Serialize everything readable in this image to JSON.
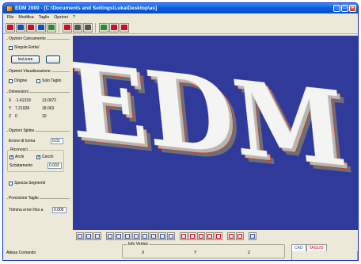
{
  "window": {
    "title": "EDM 2000 - [C:\\Documents and Settings\\Luka\\Desktop\\as]",
    "controls": [
      "_",
      "□",
      "×"
    ]
  },
  "menu": [
    "File",
    "Modifica",
    "Taglio",
    "Opzioni",
    "?"
  ],
  "toolbar": {
    "buttons": [
      {
        "icon": "open-folder-icon",
        "color": "#c8102e"
      },
      {
        "icon": "open-file-icon",
        "color": "#1a4fb5"
      },
      {
        "icon": "save-file-icon",
        "color": "#c8102e"
      },
      {
        "icon": "import-file-icon",
        "color": "#1a4fb5"
      },
      {
        "icon": "export-icon",
        "color": "#2e8b2e"
      },
      {
        "icon": "home-icon",
        "color": "#c8102e"
      },
      {
        "icon": "edit-icon",
        "color": "#555555"
      },
      {
        "icon": "shape-icon",
        "color": "#555555"
      },
      {
        "icon": "disk-icon",
        "color": "#2e8b2e"
      },
      {
        "icon": "print-icon",
        "color": "#c8102e"
      },
      {
        "icon": "exit-icon",
        "color": "#c8102e"
      }
    ]
  },
  "left_panel": {
    "opzioni_caricamento": {
      "title": "Opzioni Caricamento",
      "singola_entita": "Singole Entita'",
      "isolinee_button": "IsoLinee"
    },
    "opzioni_visualizzazione": {
      "title": "Opzioni Visualizzazione",
      "origine": "Origine",
      "solo_taglio": "Solo Taglio"
    },
    "dimensioni": {
      "title": "Dimensioni",
      "rows": [
        {
          "axis": "X",
          "min": "-1.41318",
          "max": "13.0072"
        },
        {
          "axis": "Y",
          "min": "7.21928",
          "max": "18.063"
        },
        {
          "axis": "Z",
          "min": "0",
          "max": "10"
        }
      ]
    },
    "opzioni_spline": {
      "title": "Opzioni Spline",
      "errore_label": "Errore di forma",
      "errore_value": "0.01",
      "riconosci_title": "Riconosci",
      "archi": "Archi",
      "cerchi": "Cerchi",
      "scostamento_label": "Scostamento",
      "scostamento_value": "0.003",
      "spezza_segmenti": "Spezza Segmenti"
    },
    "precisione_taglio": {
      "title": "Precisione Taglio",
      "trimma_label": "Trimma errori fino a",
      "trimma_value": "0.005"
    }
  },
  "viewport": {
    "text": "EDM",
    "background": "#2f3a9a"
  },
  "info_vertice": {
    "title": "Info Vertice",
    "x_label": "X",
    "y_label": "Y",
    "z_label": "Z"
  },
  "status": {
    "left": "Attesa Comando"
  },
  "tabs": [
    "CAD",
    "TAGLIO"
  ]
}
